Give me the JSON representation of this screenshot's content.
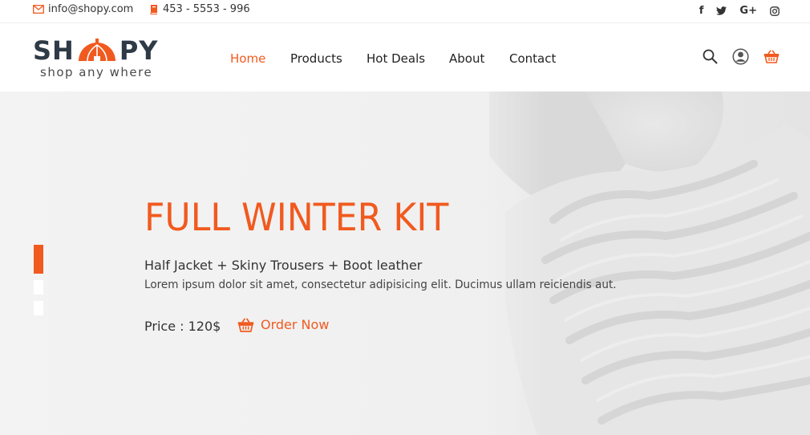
{
  "topbar": {
    "email": "info@shopy.com",
    "phone": "453 - 5553 - 996",
    "social": [
      {
        "icon": "facebook-icon",
        "glyph": "f"
      },
      {
        "icon": "twitter-icon",
        "glyph": ""
      },
      {
        "icon": "google-plus-icon",
        "glyph": "G+"
      },
      {
        "icon": "instagram-icon",
        "glyph": ""
      }
    ]
  },
  "header": {
    "logo": {
      "left": "SH",
      "right": "PY",
      "tagline": "shop any where"
    },
    "nav": [
      {
        "label": "Home",
        "active": true
      },
      {
        "label": "Products",
        "active": false
      },
      {
        "label": "Hot Deals",
        "active": false
      },
      {
        "label": "About",
        "active": false
      },
      {
        "label": "Contact",
        "active": false
      }
    ],
    "icons": [
      "search-icon",
      "user-icon",
      "cart-icon"
    ]
  },
  "hero": {
    "title": "FULL WINTER KIT",
    "subtitle": "Half Jacket + Skiny Trousers + Boot leather",
    "description": "Lorem ipsum dolor sit amet, consectetur adipisicing elit. Ducimus ullam reiciendis aut.",
    "price": "Price : 120$",
    "order_label": "Order Now",
    "slides": 3,
    "active_slide": 0
  },
  "colors": {
    "accent": "#f15a1f",
    "dark": "#2e3a46"
  }
}
